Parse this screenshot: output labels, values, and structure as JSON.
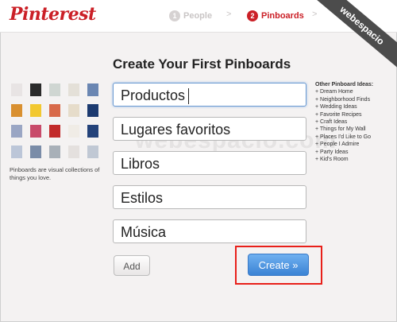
{
  "header": {
    "logo": "Pinterest",
    "steps": [
      {
        "num": "1",
        "label": "People"
      },
      {
        "num": "2",
        "label": "Pinboards"
      }
    ],
    "step_separator": ">"
  },
  "ribbon_text": "webespacio",
  "watermark_text": "webespacio.com",
  "main": {
    "title": "Create Your First Pinboards",
    "boards": [
      "Productos",
      "Lugares favoritos",
      "Libros",
      "Estilos",
      "Música"
    ],
    "add_label": "Add",
    "create_label": "Create »"
  },
  "left": {
    "caption": "Pinboards are visual collections of things you love."
  },
  "ideas": {
    "heading": "Other Pinboard Ideas:",
    "items": [
      "+ Dream Home",
      "+ Neighborhood Finds",
      "+ Wedding Ideas",
      "+ Favorite Recipes",
      "+ Craft Ideas",
      "+ Things for My Wall",
      "+ Places I'd Like to Go",
      "+ People I Admire",
      "+ Party Ideas",
      "+ Kid's Room"
    ]
  },
  "colors": {
    "brand_red": "#cb2027",
    "create_blue": "#3b83d4",
    "highlight_red": "#e8201a"
  },
  "icons": [
    "pinboard-thumbnail-icon"
  ]
}
